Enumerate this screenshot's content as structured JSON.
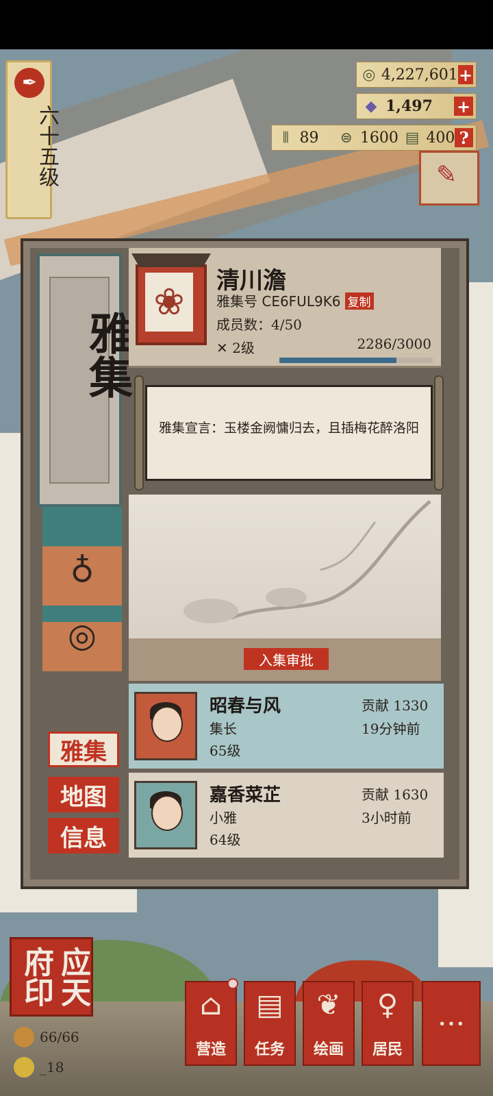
{
  "player": {
    "level_label": "六十五级",
    "level_icon": "brush-seal-icon"
  },
  "resources": {
    "coins": "4,227,601",
    "gems": "1,497",
    "wood": "89",
    "grain": "1600",
    "books": "400",
    "help": "?",
    "plus": "+"
  },
  "side_tabs": {
    "yaji": "雅集",
    "map": "地图",
    "info": "信息"
  },
  "panel": {
    "title": "雅集",
    "club_name": "清川澹",
    "club_id_label": "雅集号 CE6FUL9K6",
    "copy_label": "复制",
    "members_label": "成员数：4/50",
    "level_label": "2级",
    "exp_text": "2286/3000",
    "exp_fraction": 0.762,
    "declaration": "雅集宣言：玉楼金阙慵归去，且插梅花醉洛阳",
    "approve_label": "入集审批"
  },
  "members": [
    {
      "name": "昭春与风",
      "role": "集长",
      "level": "65级",
      "contribution": "贡献  1330",
      "last_active": "19分钟前"
    },
    {
      "name": "嘉香菜芷",
      "role": "小雅",
      "level": "64级",
      "contribution": "贡献  1630",
      "last_active": "3小时前"
    }
  ],
  "seal": {
    "text": "应天府印",
    "stat1": "66/66",
    "stat2": "_18"
  },
  "nav": [
    {
      "label": "营造",
      "icon": "build-icon"
    },
    {
      "label": "任务",
      "icon": "scroll-icon"
    },
    {
      "label": "绘画",
      "icon": "painting-icon"
    },
    {
      "label": "居民",
      "icon": "resident-icon"
    },
    {
      "label": "",
      "icon": "more-icon"
    }
  ],
  "colors": {
    "accent_red": "#c03322",
    "teal": "#4a6a6b",
    "exp_bar": "#3d6b8c"
  }
}
